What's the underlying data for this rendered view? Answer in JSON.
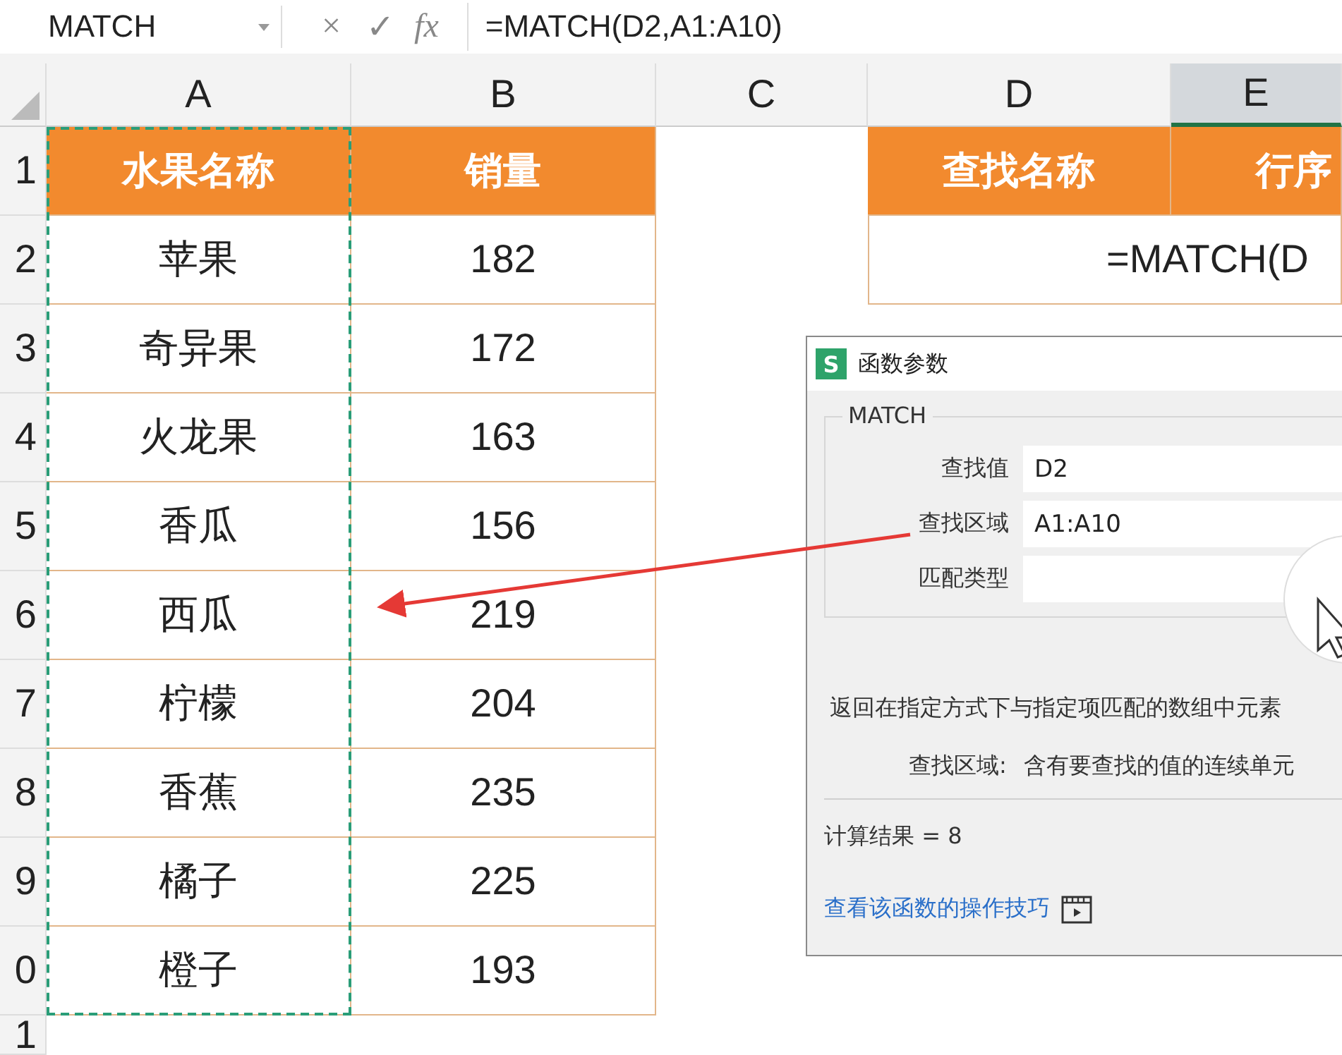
{
  "name_box": {
    "value": "MATCH"
  },
  "formula_bar": {
    "cancel": "×",
    "confirm": "✓",
    "fx": "fx",
    "formula": "=MATCH(D2,A1:A10)"
  },
  "columns": [
    {
      "label": "A",
      "selected": false
    },
    {
      "label": "B",
      "selected": false
    },
    {
      "label": "C",
      "selected": false
    },
    {
      "label": "D",
      "selected": false
    },
    {
      "label": "E",
      "selected": true
    }
  ],
  "rows": [
    {
      "number": "1",
      "kind": "header",
      "a": "水果名称",
      "b": "销量"
    },
    {
      "number": "2",
      "kind": "data",
      "a": "苹果",
      "b": "182"
    },
    {
      "number": "3",
      "kind": "data",
      "a": "奇异果",
      "b": "172"
    },
    {
      "number": "4",
      "kind": "data",
      "a": "火龙果",
      "b": "163"
    },
    {
      "number": "5",
      "kind": "data",
      "a": "香瓜",
      "b": "156"
    },
    {
      "number": "6",
      "kind": "data",
      "a": "西瓜",
      "b": "219"
    },
    {
      "number": "7",
      "kind": "data",
      "a": "柠檬",
      "b": "204"
    },
    {
      "number": "8",
      "kind": "data",
      "a": "香蕉",
      "b": "235"
    },
    {
      "number": "9",
      "kind": "data",
      "a": "橘子",
      "b": "225"
    },
    {
      "number": "0",
      "kind": "data",
      "a": "橙子",
      "b": "193"
    },
    {
      "number": "1",
      "kind": "empty"
    }
  ],
  "lookup": {
    "header_d": "查找名称",
    "header_e": "行序",
    "formula": "=MATCH(D"
  },
  "dialog": {
    "app_icon": "S",
    "title": "函数参数",
    "group": "MATCH",
    "args": [
      {
        "label": "查找值",
        "value": "D2"
      },
      {
        "label": "查找区域",
        "value": "A1:A10"
      },
      {
        "label": "匹配类型"
      }
    ],
    "description": "返回在指定方式下与指定项匹配的数组中元素",
    "arg_help": {
      "label": "查找区域:",
      "text": "含有要查找的值的连续单元"
    },
    "result": "计算结果 = 8",
    "link": "查看该函数的操作技巧"
  }
}
